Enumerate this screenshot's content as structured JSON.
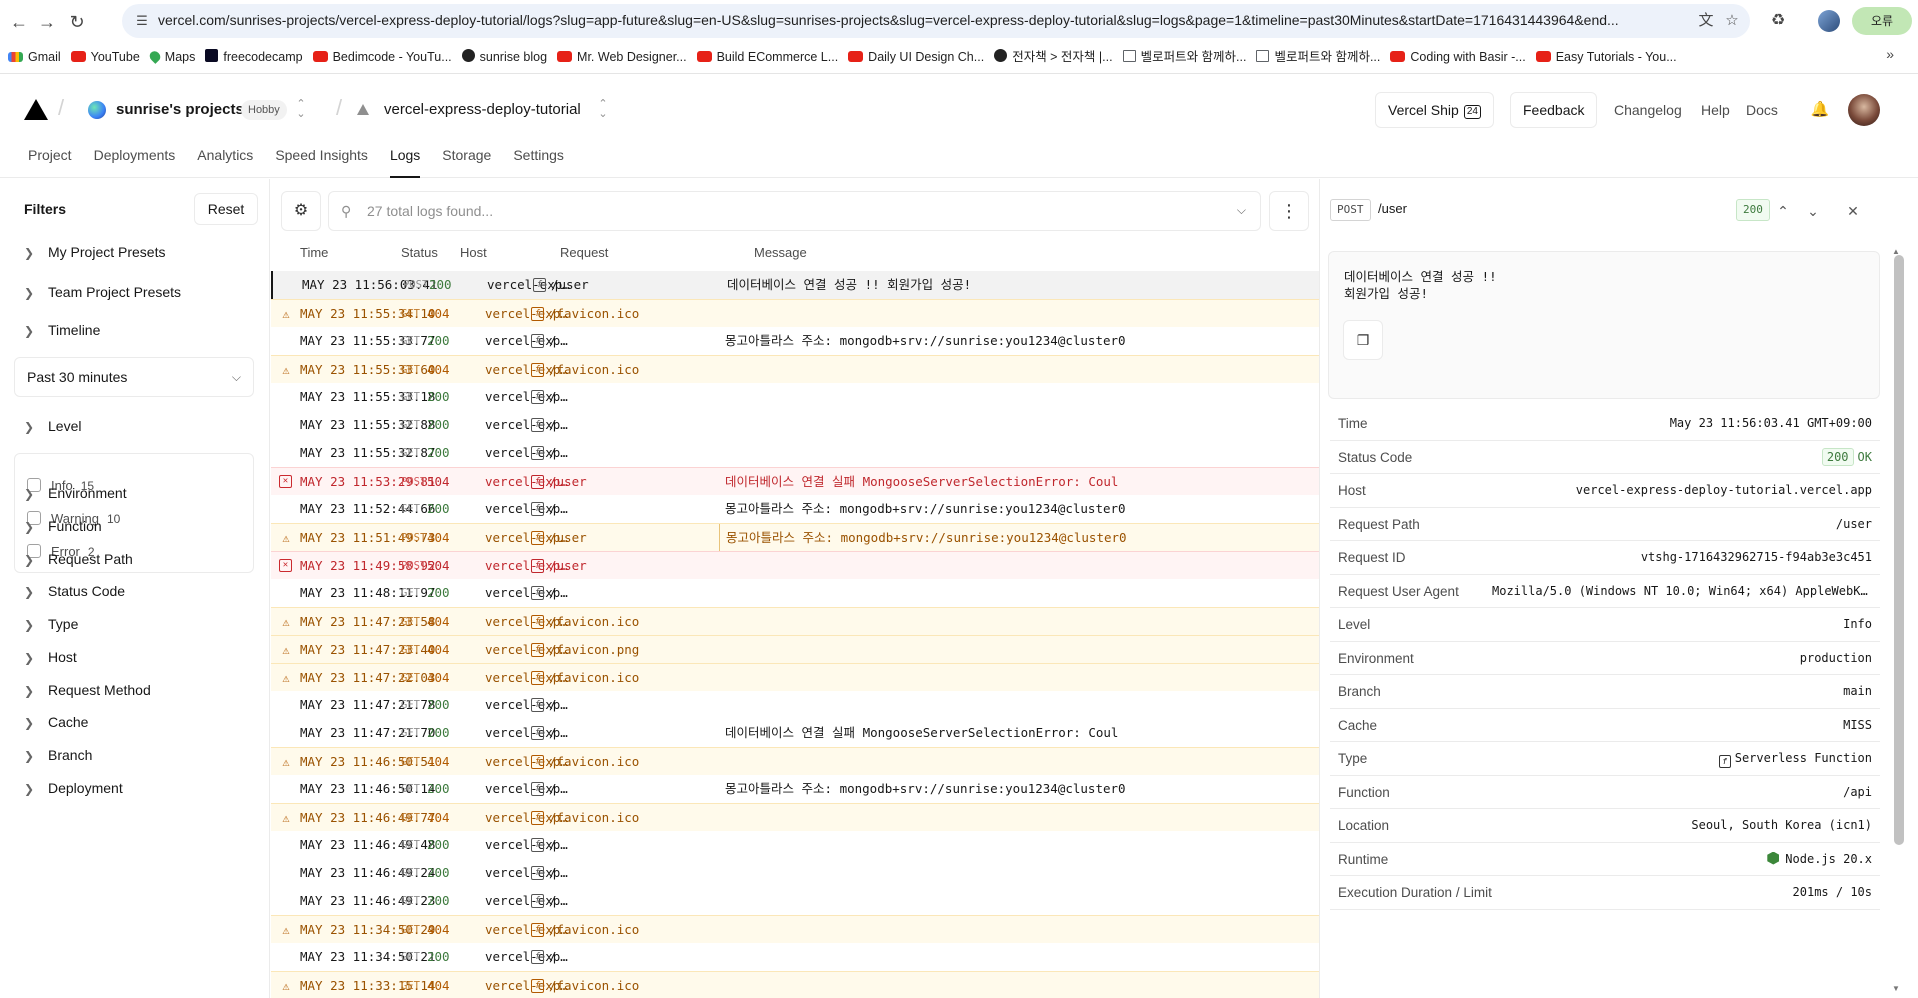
{
  "browser": {
    "url": "vercel.com/sunrises-projects/vercel-express-deploy-tutorial/logs?slug=app-future&slug=en-US&slug=sunrises-projects&slug=vercel-express-deploy-tutorial&slug=logs&page=1&timeline=past30Minutes&startDate=1716431443964&end...",
    "profile_label": "오류",
    "bookmarks": [
      {
        "icon": "gmail-icon",
        "label": "Gmail"
      },
      {
        "icon": "youtube-icon",
        "label": "YouTube"
      },
      {
        "icon": "maps-icon",
        "label": "Maps"
      },
      {
        "icon": "freecodecamp-icon",
        "label": "freecodecamp"
      },
      {
        "icon": "youtube-icon",
        "label": "Bedimcode - YouTu..."
      },
      {
        "icon": "github-icon",
        "label": "sunrise blog"
      },
      {
        "icon": "youtube-icon",
        "label": "Mr. Web Designer..."
      },
      {
        "icon": "youtube-icon",
        "label": "Build ECommerce L..."
      },
      {
        "icon": "youtube-icon",
        "label": "Daily UI Design Ch..."
      },
      {
        "icon": "github-icon",
        "label": "전자책 > 전자책 |..."
      },
      {
        "icon": "book-icon",
        "label": "벨로퍼트와 함께하..."
      },
      {
        "icon": "book-icon",
        "label": "벨로퍼트와 함께하..."
      },
      {
        "icon": "youtube-icon",
        "label": "Coding with Basir -..."
      },
      {
        "icon": "youtube-icon",
        "label": "Easy Tutorials - You..."
      }
    ]
  },
  "header": {
    "team_name": "sunrise's projects",
    "plan_badge": "Hobby",
    "project_name": "vercel-express-deploy-tutorial",
    "ship_label": "Vercel Ship",
    "ship_badge": "24",
    "feedback_label": "Feedback",
    "links": [
      "Changelog",
      "Help",
      "Docs"
    ],
    "tabs": [
      "Project",
      "Deployments",
      "Analytics",
      "Speed Insights",
      "Logs",
      "Storage",
      "Settings"
    ],
    "active_tab": "Logs"
  },
  "filters": {
    "title": "Filters",
    "reset_label": "Reset",
    "groups_top": [
      "My Project Presets",
      "Team Project Presets"
    ],
    "timeline_label": "Timeline",
    "timeline_value": "Past 30 minutes",
    "level_label": "Level",
    "levels": [
      {
        "label": "Info",
        "count": "15"
      },
      {
        "label": "Warning",
        "count": "10"
      },
      {
        "label": "Error",
        "count": "2"
      }
    ],
    "groups_bottom": [
      "Environment",
      "Function",
      "Request Path",
      "Status Code",
      "Type",
      "Host",
      "Request Method",
      "Cache",
      "Branch",
      "Deployment"
    ]
  },
  "logs": {
    "search_placeholder": "27 total logs found...",
    "columns": [
      "Time",
      "Status",
      "Host",
      "Request",
      "Message"
    ],
    "rows": [
      {
        "level": "info",
        "selected": true,
        "time": "MAY 23 11:56:03.41",
        "method": "POST",
        "status": "200",
        "host": "vercel-express-deploy-tutorial.vercel.app",
        "path": "/user",
        "message": "데이터베이스 연결 성공 !! 회원가입 성공!"
      },
      {
        "level": "warn",
        "time": "MAY 23 11:55:34.10",
        "method": "GET",
        "status": "404",
        "host": "vercel-express-deploy-tutorial.vercel.app",
        "path": "/favicon.ico",
        "message": ""
      },
      {
        "level": "info",
        "time": "MAY 23 11:55:33.77",
        "method": "GET",
        "status": "200",
        "host": "vercel-express-deploy-tutorial.vercel.app",
        "path": "/",
        "message": "몽고아틀라스 주소: mongodb+srv://sunrise:you1234@cluster0"
      },
      {
        "level": "warn",
        "time": "MAY 23 11:55:33.60",
        "method": "GET",
        "status": "404",
        "host": "vercel-express-deploy-tutorial.vercel.app",
        "path": "/favicon.ico",
        "message": ""
      },
      {
        "level": "info",
        "time": "MAY 23 11:55:33.18",
        "method": "GET",
        "status": "200",
        "host": "vercel-express-deploy-tutorial.vercel.app",
        "path": "/",
        "message": ""
      },
      {
        "level": "info",
        "time": "MAY 23 11:55:32.88",
        "method": "GET",
        "status": "200",
        "host": "vercel-express-deploy-tutorial.vercel.app",
        "path": "/",
        "message": ""
      },
      {
        "level": "info",
        "time": "MAY 23 11:55:32.87",
        "method": "GET",
        "status": "200",
        "host": "vercel-express-deploy-tutorial.vercel.app",
        "path": "/",
        "message": ""
      },
      {
        "level": "err",
        "time": "MAY 23 11:53:29.81",
        "method": "POST",
        "status": "504",
        "host": "vercel-express-deploy-tutorial.vercel.app",
        "path": "/user",
        "message": "데이터베이스 연결 실패 MongooseServerSelectionError: Coul"
      },
      {
        "level": "info",
        "time": "MAY 23 11:52:44.66",
        "method": "GET",
        "status": "200",
        "host": "vercel-express-deploy-tutorial.vercel.app",
        "path": "/",
        "message": "몽고아틀라스 주소: mongodb+srv://sunrise:you1234@cluster0"
      },
      {
        "level": "warn",
        "time": "MAY 23 11:51:49.73",
        "method": "POST",
        "status": "404",
        "host": "vercel-express-deploy-tutorial.vercel.app",
        "path": "/user",
        "message": "몽고아틀라스 주소: mongodb+srv://sunrise:you1234@cluster0"
      },
      {
        "level": "err",
        "time": "MAY 23 11:49:58.92",
        "method": "POST",
        "status": "504",
        "host": "vercel-express-deploy-tutorial.vercel.app",
        "path": "/user",
        "message": ""
      },
      {
        "level": "info",
        "time": "MAY 23 11:48:11.97",
        "method": "GET",
        "status": "200",
        "host": "vercel-express-deploy-tutorial.vercel.app",
        "path": "/",
        "message": ""
      },
      {
        "level": "warn",
        "time": "MAY 23 11:47:23.58",
        "method": "GET",
        "status": "404",
        "host": "vercel-express-deploy-tutorial.vercel.app",
        "path": "/favicon.ico",
        "message": ""
      },
      {
        "level": "warn",
        "time": "MAY 23 11:47:23.40",
        "method": "GET",
        "status": "404",
        "host": "vercel-express-deploy-tutorial.vercel.app",
        "path": "/favicon.png",
        "message": ""
      },
      {
        "level": "warn",
        "time": "MAY 23 11:47:22.03",
        "method": "GET",
        "status": "404",
        "host": "vercel-express-deploy-tutorial.vercel.app",
        "path": "/favicon.ico",
        "message": ""
      },
      {
        "level": "info",
        "time": "MAY 23 11:47:21.78",
        "method": "GET",
        "status": "200",
        "host": "vercel-express-deploy-tutorial.vercel.app",
        "path": "/",
        "message": ""
      },
      {
        "level": "info",
        "time": "MAY 23 11:47:21.70",
        "method": "GET",
        "status": "200",
        "host": "vercel-express-deploy-tutorial.vercel.app",
        "path": "/",
        "message": "데이터베이스 연결 실패 MongooseServerSelectionError: Coul"
      },
      {
        "level": "warn",
        "time": "MAY 23 11:46:50.51",
        "method": "GET",
        "status": "404",
        "host": "vercel-express-deploy-tutorial.vercel.app",
        "path": "/favicon.ico",
        "message": ""
      },
      {
        "level": "info",
        "time": "MAY 23 11:46:50.14",
        "method": "GET",
        "status": "200",
        "host": "vercel-express-deploy-tutorial.vercel.app",
        "path": "/",
        "message": "몽고아틀라스 주소: mongodb+srv://sunrise:you1234@cluster0"
      },
      {
        "level": "warn",
        "time": "MAY 23 11:46:49.77",
        "method": "GET",
        "status": "404",
        "host": "vercel-express-deploy-tutorial.vercel.app",
        "path": "/favicon.ico",
        "message": ""
      },
      {
        "level": "info",
        "time": "MAY 23 11:46:49.48",
        "method": "GET",
        "status": "200",
        "host": "vercel-express-deploy-tutorial.vercel.app",
        "path": "/",
        "message": ""
      },
      {
        "level": "info",
        "time": "MAY 23 11:46:49.24",
        "method": "GET",
        "status": "200",
        "host": "vercel-express-deploy-tutorial.vercel.app",
        "path": "/",
        "message": ""
      },
      {
        "level": "info",
        "time": "MAY 23 11:46:49.23",
        "method": "GET",
        "status": "200",
        "host": "vercel-express-deploy-tutorial.vercel.app",
        "path": "/",
        "message": ""
      },
      {
        "level": "warn",
        "time": "MAY 23 11:34:50.29",
        "method": "GET",
        "status": "404",
        "host": "vercel-express-deploy-tutorial.vercel.app",
        "path": "/favicon.ico",
        "message": ""
      },
      {
        "level": "info",
        "time": "MAY 23 11:34:50.21",
        "method": "GET",
        "status": "200",
        "host": "vercel-express-deploy-tutorial.vercel.app",
        "path": "/",
        "message": ""
      },
      {
        "level": "warn",
        "time": "MAY 23 11:33:15.14",
        "method": "GET",
        "status": "404",
        "host": "vercel-express-deploy-tutorial.vercel.app",
        "path": "/favicon.ico",
        "message": ""
      }
    ]
  },
  "detail": {
    "method": "POST",
    "path": "/user",
    "status": "200",
    "message": "데이터베이스 연결 성공 !!\n회원가입 성공!",
    "properties": [
      {
        "key": "Time",
        "value": "May 23 11:56:03.41 GMT+09:00"
      },
      {
        "key": "Status Code",
        "value": "200",
        "extra": "OK"
      },
      {
        "key": "Host",
        "value": "vercel-express-deploy-tutorial.vercel.app"
      },
      {
        "key": "Request Path",
        "value": "/user"
      },
      {
        "key": "Request ID",
        "value": "vtshg-1716432962715-f94ab3e3c451"
      },
      {
        "key": "Request User Agent",
        "value": "Mozilla/5.0 (Windows NT 10.0; Win64; x64) AppleWebKit/537.36"
      },
      {
        "key": "Level",
        "value": "Info"
      },
      {
        "key": "Environment",
        "value": "production"
      },
      {
        "key": "Branch",
        "value": "main"
      },
      {
        "key": "Cache",
        "value": "MISS"
      },
      {
        "key": "Type",
        "value": "Serverless Function"
      },
      {
        "key": "Function",
        "value": "/api"
      },
      {
        "key": "Location",
        "value": "Seoul, South Korea (icn1)"
      },
      {
        "key": "Runtime",
        "value": "Node.js 20.x"
      },
      {
        "key": "Execution Duration / Limit",
        "value": "201ms / 10s"
      }
    ]
  },
  "colors": {
    "warning_bg": "#fffaeb",
    "warning_text": "#9a5200",
    "error_bg": "#fff4f4",
    "error_text": "#c0272d",
    "ok_text": "#3d7a3d"
  }
}
